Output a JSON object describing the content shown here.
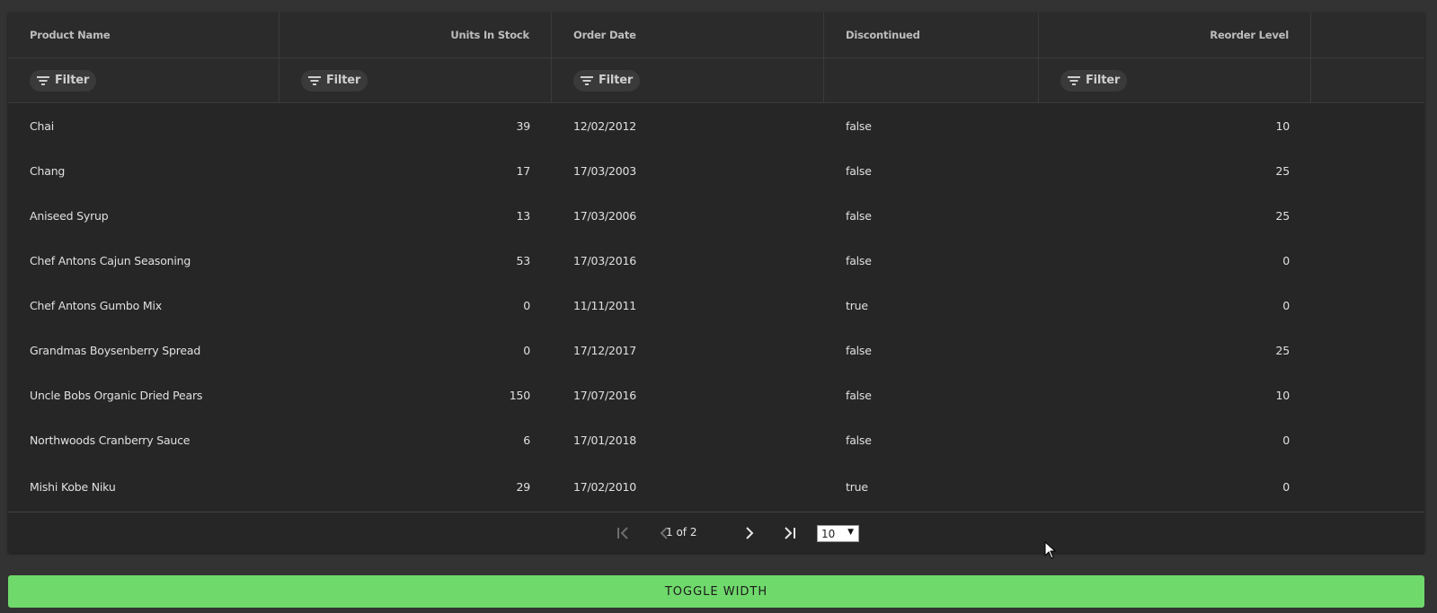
{
  "columns": [
    {
      "label": "Product Name",
      "align": "left"
    },
    {
      "label": "Units In Stock",
      "align": "right"
    },
    {
      "label": "Order Date",
      "align": "left"
    },
    {
      "label": "Discontinued",
      "align": "left"
    },
    {
      "label": "Reorder Level",
      "align": "right"
    }
  ],
  "filter_label": "Filter",
  "rows": [
    [
      "Chai",
      "39",
      "12/02/2012",
      "false",
      "10"
    ],
    [
      "Chang",
      "17",
      "17/03/2003",
      "false",
      "25"
    ],
    [
      "Aniseed Syrup",
      "13",
      "17/03/2006",
      "false",
      "25"
    ],
    [
      "Chef Antons Cajun Seasoning",
      "53",
      "17/03/2016",
      "false",
      "0"
    ],
    [
      "Chef Antons Gumbo Mix",
      "0",
      "11/11/2011",
      "true",
      "0"
    ],
    [
      "Grandmas Boysenberry Spread",
      "0",
      "17/12/2017",
      "false",
      "25"
    ],
    [
      "Uncle Bobs Organic Dried Pears",
      "150",
      "17/07/2016",
      "false",
      "10"
    ],
    [
      "Northwoods Cranberry Sauce",
      "6",
      "17/01/2018",
      "false",
      "0"
    ],
    [
      "Mishi Kobe Niku",
      "29",
      "17/02/2010",
      "true",
      "0"
    ]
  ],
  "pager": {
    "label": "1 of 2",
    "page_size": "10"
  },
  "toggle_label": "TOGGLE WIDTH",
  "colors": {
    "background": "#333333",
    "grid": "#262626",
    "accent": "#6fd96b"
  }
}
